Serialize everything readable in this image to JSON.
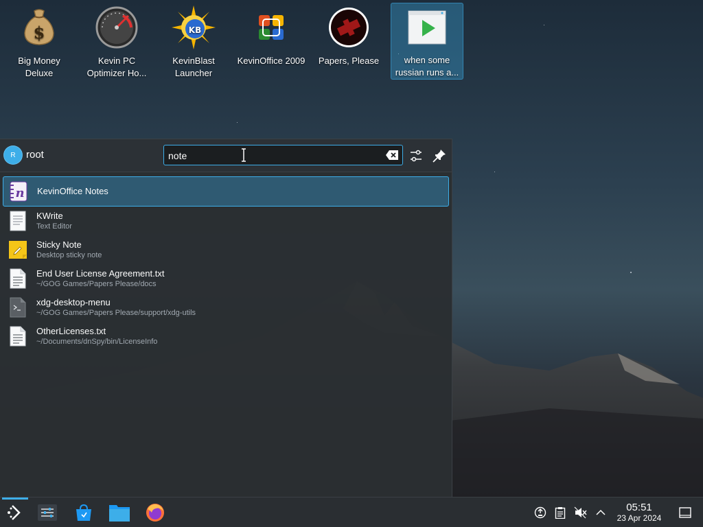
{
  "desktop": {
    "icons": [
      {
        "label": "Big Money Deluxe",
        "icon": "money-bag-icon",
        "selected": false
      },
      {
        "label": "Kevin PC Optimizer Ho...",
        "icon": "speedometer-icon",
        "selected": false
      },
      {
        "label": "KevinBlast Launcher",
        "icon": "sun-globe-icon",
        "selected": false
      },
      {
        "label": "KevinOffice 2009",
        "icon": "office-logo-icon",
        "selected": false
      },
      {
        "label": "Papers, Please",
        "icon": "papers-please-icon",
        "selected": false
      },
      {
        "label": "when some russian runs a...",
        "icon": "video-play-icon",
        "selected": true
      }
    ]
  },
  "launcher": {
    "avatar_initial": "R",
    "username": "root",
    "search": {
      "value": "note",
      "placeholder": ""
    },
    "results": [
      {
        "title": "KevinOffice Notes",
        "subtitle": "",
        "icon": "notes-app-icon",
        "active": true
      },
      {
        "title": "KWrite",
        "subtitle": "Text Editor",
        "icon": "text-editor-icon",
        "active": false
      },
      {
        "title": "Sticky Note",
        "subtitle": "Desktop sticky note",
        "icon": "sticky-note-icon",
        "active": false
      },
      {
        "title": "End User License Agreement.txt",
        "subtitle": "~/GOG Games/Papers Please/docs",
        "icon": "text-file-icon",
        "active": false
      },
      {
        "title": "xdg-desktop-menu",
        "subtitle": "~/GOG Games/Papers Please/support/xdg-utils",
        "icon": "script-file-icon",
        "active": false
      },
      {
        "title": "OtherLicenses.txt",
        "subtitle": "~/Documents/dnSpy/bin/LicenseInfo",
        "icon": "text-file-icon",
        "active": false
      }
    ]
  },
  "taskbar": {
    "clock": {
      "time": "05:51",
      "date": "23 Apr 2024"
    }
  },
  "colors": {
    "accent": "#3daee9",
    "panel": "#2a2e32",
    "text": "#fcfcfc"
  }
}
